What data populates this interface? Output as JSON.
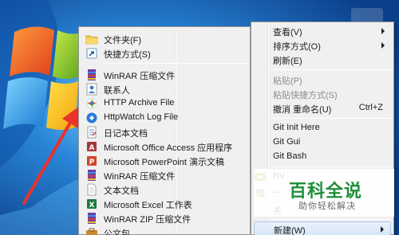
{
  "submenu": {
    "items": [
      {
        "label": "文件夹(F)",
        "icon": "folder-icon"
      },
      {
        "label": "快捷方式(S)",
        "icon": "shortcut-icon"
      },
      {
        "label": "WinRAR 压缩文件",
        "icon": "winrar-archive-icon"
      },
      {
        "label": "联系人",
        "icon": "contact-icon"
      },
      {
        "label": "HTTP Archive File",
        "icon": "http-archive-icon"
      },
      {
        "label": "HttpWatch Log File",
        "icon": "httpwatch-log-icon"
      },
      {
        "label": "日记本文档",
        "icon": "journal-icon"
      },
      {
        "label": "Microsoft Office Access 应用程序",
        "icon": "access-icon"
      },
      {
        "label": "Microsoft PowerPoint 演示文稿",
        "icon": "powerpoint-icon"
      },
      {
        "label": "WinRAR 压缩文件",
        "icon": "winrar-archive-icon"
      },
      {
        "label": "文本文档",
        "icon": "text-document-icon"
      },
      {
        "label": "Microsoft Excel 工作表",
        "icon": "excel-icon"
      },
      {
        "label": "WinRAR ZIP 压缩文件",
        "icon": "winrar-zip-icon"
      },
      {
        "label": "公文包",
        "icon": "briefcase-icon"
      }
    ]
  },
  "mainmenu": {
    "view": "查看(V)",
    "sort": "排序方式(O)",
    "refresh": "刷新(E)",
    "paste": "粘贴(P)",
    "paste_shortcut": "粘贴快捷方式(S)",
    "undo_rename": "撤消 重命名(U)",
    "undo_shortcut": "Ctrl+Z",
    "git_init": "Git Init Here",
    "git_gui": "Git Gui",
    "git_bash": "Git Bash",
    "nvidia": "NV",
    "personalize_partial": "—",
    "partial_bottom": "关",
    "new": "新建(W)"
  },
  "watermark": {
    "title": "百科全说",
    "subtitle": "助你轻松解决"
  },
  "colors": {
    "desktop_blue": "#1b6fc4",
    "menu_bg": "#f0f0f0",
    "highlight": "#d5e6f8",
    "arrow_red": "#e8322b",
    "watermark_green": "#1f8f3a"
  }
}
